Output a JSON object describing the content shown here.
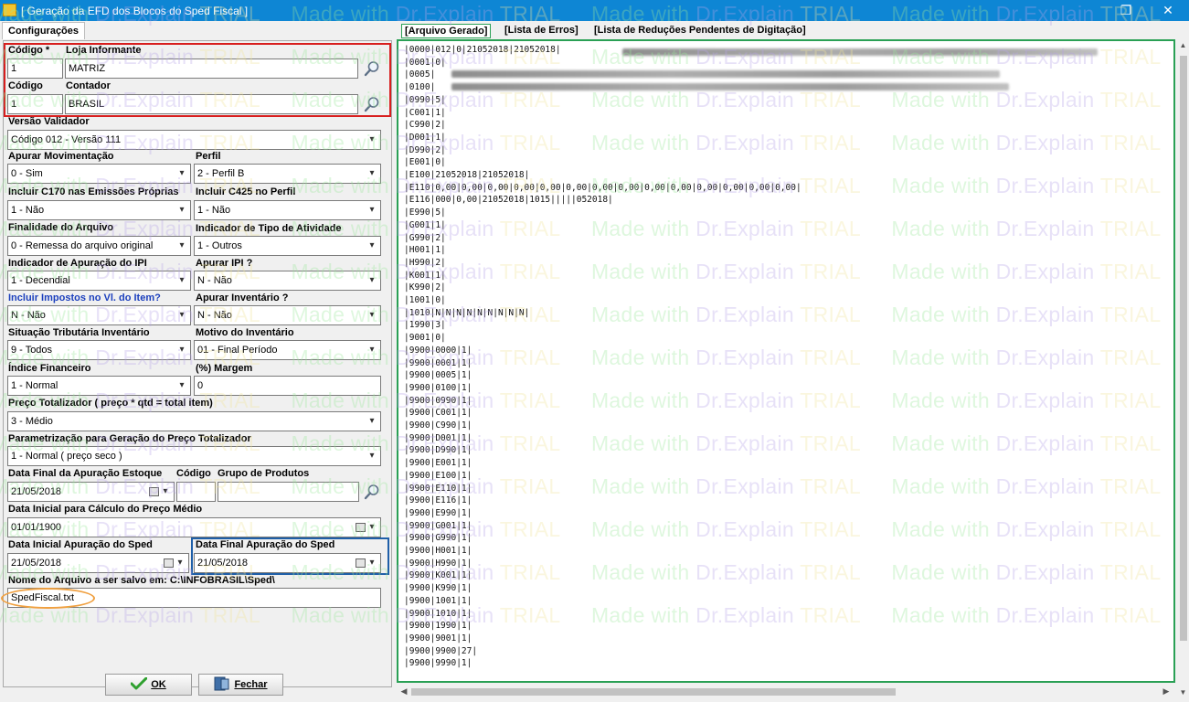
{
  "window": {
    "title": "[ Geração da EFD dos Blocos do Sped Fiscal ]",
    "restore_glyph": "❐",
    "close_glyph": "✕"
  },
  "left": {
    "tab": "Configurações",
    "codigo_label": "Código *",
    "codigo_value": "1",
    "loja_label": "Loja Informante",
    "loja_value": "MATRIZ",
    "codigo2_label": "Código",
    "codigo2_value": "1",
    "contador_label": "Contador",
    "contador_value": "BRASIL",
    "versao_label": "Versão Validador",
    "versao_value": "Código 012 - Versão 111",
    "apurar_mov_label": "Apurar Movimentação",
    "apurar_mov_value": "0 - Sim",
    "perfil_label": "Perfil",
    "perfil_value": "2 - Perfil B",
    "c170_label": "Incluir C170 nas Emissões Próprias",
    "c170_value": "1 - Não",
    "c425_label": "Incluir C425 no Perfil",
    "c425_value": "1 - Não",
    "finalidade_label": "Finalidade do Arquivo",
    "finalidade_value": "0 - Remessa do arquivo original",
    "tipo_ativ_label": "Indicador de Tipo de Atividade",
    "tipo_ativ_value": "1 - Outros",
    "ind_ipi_label": "Indicador de Apuração do IPI",
    "ind_ipi_value": "1 - Decendial",
    "apurar_ipi_label": "Apurar IPI ?",
    "apurar_ipi_value": "N - Não",
    "impostos_label": "Incluir Impostos no Vl. do Item?",
    "impostos_value": "N - Não",
    "apurar_inv_label": "Apurar Inventário ?",
    "apurar_inv_value": "N - Não",
    "sit_trib_label": "Situação Tributária Inventário",
    "sit_trib_value": "9 - Todos",
    "motivo_label": "Motivo do Inventário",
    "motivo_value": "01 - Final Período",
    "indice_label": "Índice Financeiro",
    "indice_value": "1 - Normal",
    "margem_label": "(%) Margem",
    "margem_value": "0",
    "preco_tot_label": "Preço Totalizador ( preço * qtd = total item)",
    "preco_tot_value": "3 - Médio",
    "param_label": "Parametrização para Geração do Preço Totalizador",
    "param_value": "1 - Normal ( preço seco )",
    "data_final_est_label": "Data Final da Apuração Estoque",
    "data_final_est_value": "21/05/2018",
    "codigo3_label": "Código",
    "grupo_label": "Grupo de Produtos",
    "data_ini_calc_label": "Data Inicial para Cálculo do Preço Médio",
    "data_ini_calc_value": "01/01/1900",
    "data_ini_sped_label": "Data Inicial Apuração do Sped",
    "data_ini_sped_value": "21/05/2018",
    "data_fim_sped_label": "Data Final Apuração do Sped",
    "data_fim_sped_value": "21/05/2018",
    "nome_arq_label": "Nome do Arquivo a ser salvo em: C:\\INFOBRASIL\\Sped\\",
    "nome_arq_value": "SpedFiscal.txt",
    "ok_label": "OK",
    "fechar_label": "Fechar"
  },
  "right": {
    "tabs": [
      "[Arquivo Gerado]",
      "[Lista de Erros]",
      "[Lista de Reduções Pendentes de Digitação]"
    ],
    "lines": [
      "|0000|012|0|21052018|21052018|",
      "|0001|0|",
      "|0005|",
      "|0100|",
      "|0990|5|",
      "|C001|1|",
      "|C990|2|",
      "|D001|1|",
      "|D990|2|",
      "|E001|0|",
      "|E100|21052018|21052018|",
      "|E110|0,00|0,00|0,00|0,00|0,00|0,00|0,00|0,00|0,00|0,00|0,00|0,00|0,00|0,00|",
      "|E116|000|0,00|21052018|1015|||||052018|",
      "|E990|5|",
      "|G001|1|",
      "|G990|2|",
      "|H001|1|",
      "|H990|2|",
      "|K001|1|",
      "|K990|2|",
      "|1001|0|",
      "|1010|N|N|N|N|N|N|N|N|N|",
      "|1990|3|",
      "|9001|0|",
      "|9900|0000|1|",
      "|9900|0001|1|",
      "|9900|0005|1|",
      "|9900|0100|1|",
      "|9900|0990|1|",
      "|9900|C001|1|",
      "|9900|C990|1|",
      "|9900|D001|1|",
      "|9900|D990|1|",
      "|9900|E001|1|",
      "|9900|E100|1|",
      "|9900|E110|1|",
      "|9900|E116|1|",
      "|9900|E990|1|",
      "|9900|G001|1|",
      "|9900|G990|1|",
      "|9900|H001|1|",
      "|9900|H990|1|",
      "|9900|K001|1|",
      "|9900|K990|1|",
      "|9900|1001|1|",
      "|9900|1010|1|",
      "|9900|1990|1|",
      "|9900|9001|1|",
      "|9900|9900|27|",
      "|9900|9990|1|"
    ]
  },
  "watermark": {
    "text_a": "Made with ",
    "text_b": "Dr.Explain ",
    "text_c": "TRIAL"
  }
}
